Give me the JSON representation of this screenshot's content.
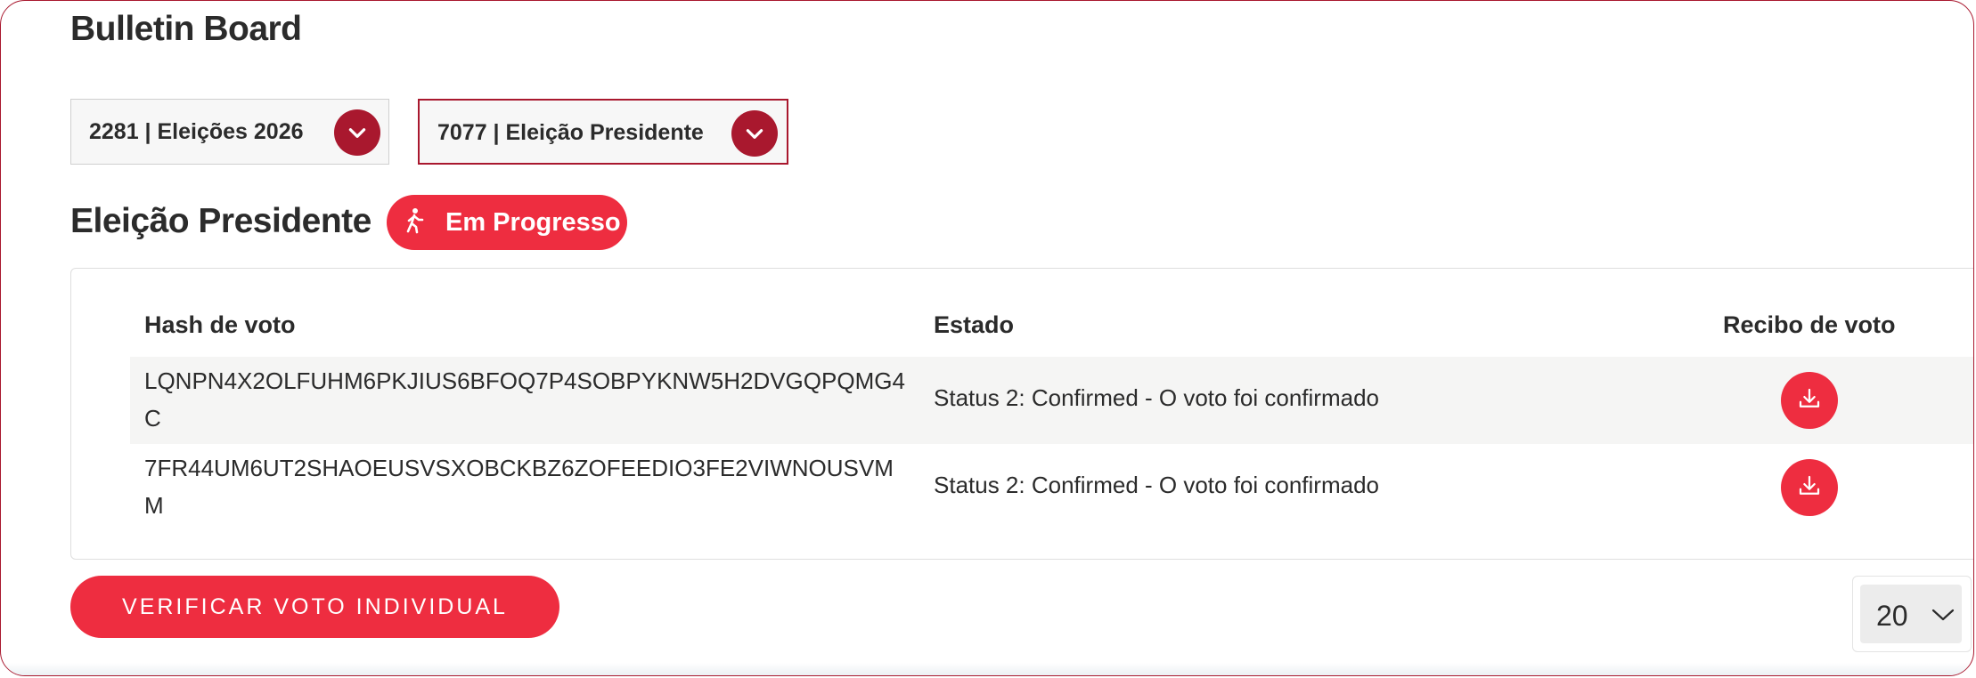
{
  "header": {
    "title": "Bulletin Board"
  },
  "selectors": [
    {
      "label": "2281 | Eleições 2026"
    },
    {
      "label": "7077 | Eleição Presidente"
    }
  ],
  "election": {
    "title": "Eleição Presidente",
    "status_label": "Em Progresso",
    "status_icon": "walking-person-icon"
  },
  "table": {
    "columns": [
      "Hash de voto",
      "Estado",
      "Recibo de voto"
    ],
    "rows": [
      {
        "hash": "LQNPN4X2OLFUHM6PKJIUS6BFOQ7P4SOBPYKNW5H2DVGQPQMG4C",
        "status": "Status 2: Confirmed - O voto foi confirmado",
        "receipt_icon": "download-icon"
      },
      {
        "hash": "7FR44UM6UT2SHAOEUSVSXOBCKBZ6ZOFEEDIO3FE2VIWNOUSVMM",
        "status": "Status 2: Confirmed - O voto foi confirmado",
        "receipt_icon": "download-icon"
      }
    ]
  },
  "actions": {
    "verify_label": "VERIFICAR VOTO INDIVIDUAL"
  },
  "pagination": {
    "page_size": "20"
  },
  "colors": {
    "accent": "#ee2d40",
    "dark_accent": "#a9182e",
    "text": "#2b2b2b",
    "stripe": "#f5f5f4"
  }
}
